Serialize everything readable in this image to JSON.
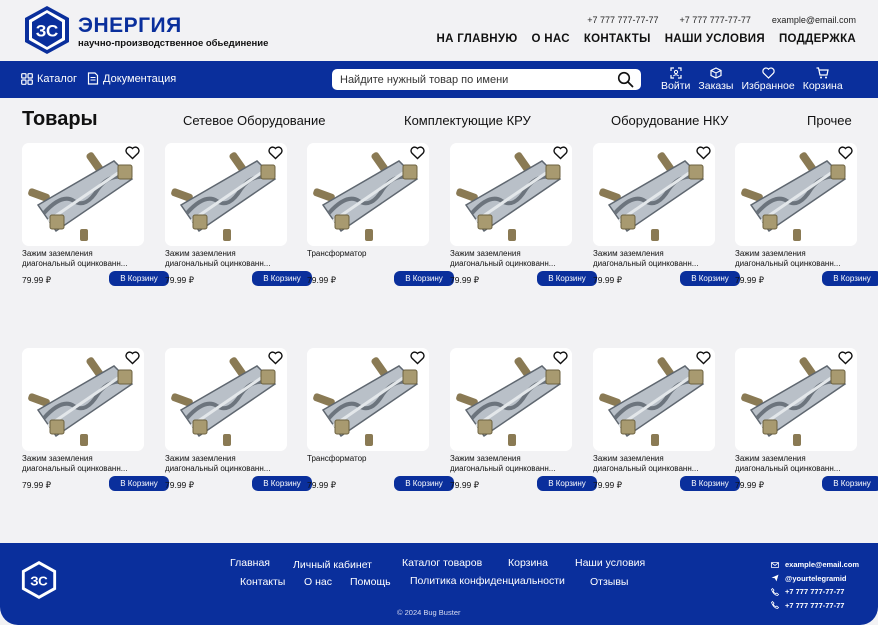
{
  "brand": {
    "name": "ЭНЕРГИЯ",
    "tagline": "научно-производственное обьединение",
    "logo_letters": "ЗС"
  },
  "contacts": {
    "phone1": "+7 777 777-77-77",
    "phone2": "+7 777 777-77-77",
    "email": "example@email.com"
  },
  "top_nav": [
    "НА ГЛАВНУЮ",
    "О НАС",
    "КОНТАКТЫ",
    "НАШИ УСЛОВИЯ",
    "ПОДДЕРЖКА"
  ],
  "bar": {
    "catalog": "Каталог",
    "docs": "Документация",
    "search_placeholder": "Найдите нужный товар по имени",
    "actions": [
      {
        "label": "Войти",
        "icon": "login-icon"
      },
      {
        "label": "Заказы",
        "icon": "box-icon"
      },
      {
        "label": "Избранное",
        "icon": "heart-icon"
      },
      {
        "label": "Корзина",
        "icon": "cart-icon"
      }
    ]
  },
  "categories": {
    "title": "Товары",
    "items": [
      "Сетевое Оборудование",
      "Комплектующие  КРУ",
      "Оборудование НКУ",
      "Прочее"
    ]
  },
  "cart_label": "В Корзину",
  "products": [
    {
      "name": "Зажим заземления диагональный оцинкованн...",
      "price": "79.99 ₽"
    },
    {
      "name": "Зажим заземления диагональный оцинкованн...",
      "price": "79.99 ₽"
    },
    {
      "name": "Трансформатор",
      "price": "79.99 ₽"
    },
    {
      "name": "Зажим заземления диагональный оцинкованн...",
      "price": "79.99 ₽"
    },
    {
      "name": "Зажим заземления диагональный оцинкованн...",
      "price": "79.99 ₽"
    },
    {
      "name": "Зажим заземления диагональный оцинкованн...",
      "price": "79.99 ₽"
    },
    {
      "name": "Зажим заземления диагональный оцинкованн...",
      "price": "79.99 ₽"
    },
    {
      "name": "Зажим заземления диагональный оцинкованн...",
      "price": "79.99 ₽"
    },
    {
      "name": "Трансформатор",
      "price": "79.99 ₽"
    },
    {
      "name": "Зажим заземления диагональный оцинкованн...",
      "price": "79.99 ₽"
    },
    {
      "name": "Зажим заземления диагональный оцинкованн...",
      "price": "79.99 ₽"
    },
    {
      "name": "Зажим заземления диагональный оцинкованн...",
      "price": "79.99 ₽"
    }
  ],
  "footer": {
    "links_row1": [
      "Главная",
      "Личный кабинет",
      "Каталог товаров",
      "Корзина",
      "Наши условия"
    ],
    "links_row2": [
      "Контакты",
      "О нас",
      "Помощь",
      "Политика конфиденциальности",
      "Отзывы"
    ],
    "copyright": "© 2024 Bug Buster",
    "email": "example@email.com",
    "telegram": "@yourtelegramid",
    "phone1": "+7 777 777-77-77",
    "phone2": "+7 777 777-77-77"
  },
  "colors": {
    "brand_blue": "#0a2f9c",
    "background": "#f2f2f4"
  }
}
